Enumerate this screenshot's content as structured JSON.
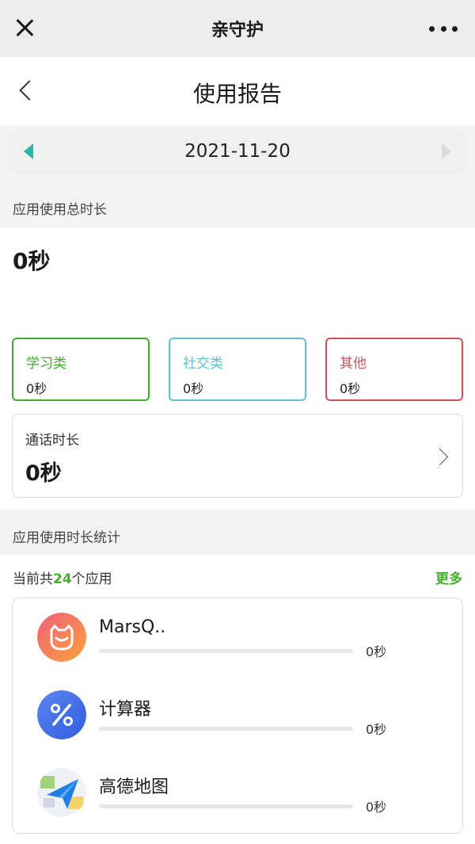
{
  "topbar": {
    "title": "亲守护"
  },
  "header": {
    "title": "使用报告"
  },
  "date_nav": {
    "date": "2021-11-20"
  },
  "total_usage": {
    "label": "应用使用总时长",
    "value": "0秒"
  },
  "categories": [
    {
      "name": "学习类",
      "value": "0秒",
      "color": "#3fae2a"
    },
    {
      "name": "社交类",
      "value": "0秒",
      "color": "#5bc4cf"
    },
    {
      "name": "其他",
      "value": "0秒",
      "color": "#d84f5a"
    }
  ],
  "call": {
    "label": "通话时长",
    "value": "0秒"
  },
  "app_stats": {
    "label": "应用使用时长统计",
    "count_prefix": "当前共",
    "count": "24",
    "count_suffix": "个应用",
    "more": "更多",
    "apps": [
      {
        "name": "MarsQ..",
        "time": "0秒",
        "progress": 0,
        "icon": "marsq-app-icon"
      },
      {
        "name": "计算器",
        "time": "0秒",
        "progress": 0,
        "icon": "calculator-app-icon"
      },
      {
        "name": "高德地图",
        "time": "0秒",
        "progress": 0,
        "icon": "amap-app-icon"
      }
    ]
  }
}
